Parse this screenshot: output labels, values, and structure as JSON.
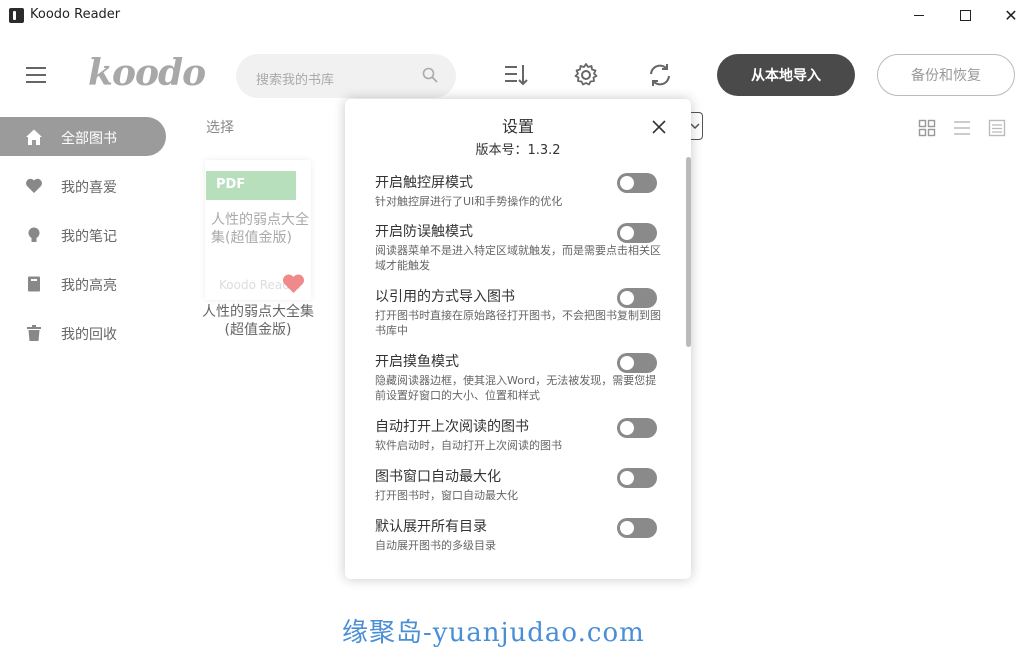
{
  "window": {
    "title": "Koodo Reader",
    "controls": {
      "minimize": "minimize",
      "maximize": "maximize",
      "close": "✕"
    }
  },
  "header": {
    "logo": "koodo",
    "search_placeholder": "搜索我的书库",
    "import_button": "从本地导入",
    "backup_button": "备份和恢复"
  },
  "sidebar": {
    "items": [
      {
        "label": "全部图书",
        "icon": "home-icon",
        "active": true
      },
      {
        "label": "我的喜爱",
        "icon": "heart-icon",
        "active": false
      },
      {
        "label": "我的笔记",
        "icon": "bulb-icon",
        "active": false
      },
      {
        "label": "我的高亮",
        "icon": "highlight-book-icon",
        "active": false
      },
      {
        "label": "我的回收",
        "icon": "trash-icon",
        "active": false
      }
    ]
  },
  "main": {
    "select_label": "选择",
    "books": [
      {
        "format": "PDF",
        "cover_title": "人性的弱点大全集(超值金版)",
        "cover_watermark": "Koodo Reader",
        "title": "人性的弱点大全集(超值金版)",
        "favorite": true
      }
    ]
  },
  "settings_modal": {
    "title": "设置",
    "version": "版本号：1.3.2",
    "items": [
      {
        "title": "开启触控屏模式",
        "desc": "针对触控屏进行了UI和手势操作的优化",
        "enabled": false
      },
      {
        "title": "开启防误触模式",
        "desc": "阅读器菜单不是进入特定区域就触发，而是需要点击相关区域才能触发",
        "enabled": false
      },
      {
        "title": "以引用的方式导入图书",
        "desc": "打开图书时直接在原始路径打开图书，不会把图书复制到图书库中",
        "enabled": false
      },
      {
        "title": "开启摸鱼模式",
        "desc": "隐藏阅读器边框，使其混入Word，无法被发现，需要您提前设置好窗口的大小、位置和样式",
        "enabled": false
      },
      {
        "title": "自动打开上次阅读的图书",
        "desc": "软件启动时，自动打开上次阅读的图书",
        "enabled": false
      },
      {
        "title": "图书窗口自动最大化",
        "desc": "打开图书时，窗口自动最大化",
        "enabled": false
      },
      {
        "title": "默认展开所有目录",
        "desc": "自动展开图书的多级目录",
        "enabled": false
      }
    ]
  },
  "watermark": "缘聚岛-yuanjudao.com",
  "colors": {
    "active_sidebar": "#9b9b9b",
    "import_button_bg": "#4a4a4a",
    "pdf_badge": "#b7dfbc",
    "favorite_heart": "#f08a8a",
    "toggle_off": "#8a8a8a",
    "watermark": "#4a8fd6"
  }
}
